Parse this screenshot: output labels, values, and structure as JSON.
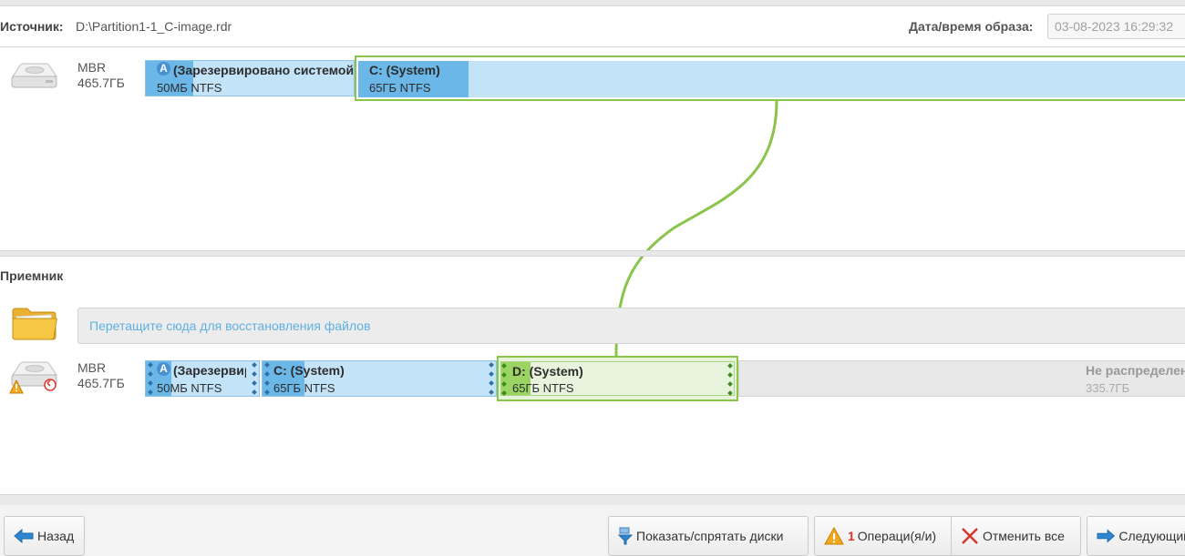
{
  "source": {
    "label": "Источник:",
    "path": "D:\\Partition1-1_C-image.rdr",
    "date_label": "Дата/время образа:",
    "date_value": "03-08-2023 16:29:32",
    "disk": {
      "type": "MBR",
      "size": "465.7ГБ",
      "partitions": [
        {
          "name": "(Зарезервировано системой)",
          "size": "50МБ NTFS",
          "icon": "system-reserved-icon",
          "used_fraction": 0.22
        },
        {
          "name": "C: (System)",
          "size": "65ГБ NTFS",
          "selected": true,
          "used_fraction": 0.13
        }
      ]
    }
  },
  "destination": {
    "label": "Приемник",
    "dropzone_text": "Перетащите сюда для восстановления файлов",
    "disk": {
      "type": "MBR",
      "size": "465.7ГБ",
      "partitions": [
        {
          "name": "(Зарезервировано системой)",
          "size": "50МБ NTFS",
          "icon": "system-reserved-icon",
          "used_fraction": 0.22
        },
        {
          "name": "C: (System)",
          "size": "65ГБ NTFS",
          "used_fraction": 0.18
        },
        {
          "name": "D: (System)",
          "size": "65ГБ NTFS",
          "state": "restore-target",
          "used_fraction": 0.07
        }
      ],
      "unallocated": {
        "name": "Не распределено",
        "size": "335.7ГБ"
      }
    }
  },
  "footer": {
    "back_label": "Назад",
    "show_hide_label": "Показать/спрятать диски",
    "ops_count": "1",
    "ops_label": "Операци(я/и)",
    "cancel_all_label": "Отменить все",
    "next_label": "Следующий"
  },
  "colors": {
    "partition_fill": "#c3e3f8",
    "partition_used": "#6ab7e8",
    "selection_green": "#8ac44b",
    "restore_fill": "#e8f3dd"
  }
}
